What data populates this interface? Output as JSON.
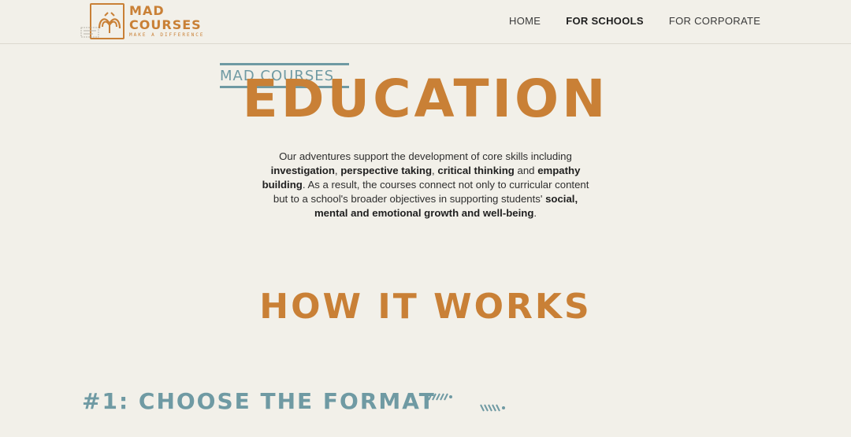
{
  "header": {
    "logo": {
      "title": "MAD COURSES",
      "tagline": "MAKE A DIFFERENCE"
    },
    "nav": {
      "items": [
        {
          "label": "HOME"
        },
        {
          "label": "FOR SCHOOLS",
          "active": true
        },
        {
          "label": "FOR CORPORATE"
        }
      ]
    }
  },
  "hero": {
    "kicker": "MAD COURSES",
    "title": "EDUCATION"
  },
  "intro": {
    "line1_pre": "Our adventures support the development of core skills including",
    "skill1": "investigation",
    "sep1": ", ",
    "skill2": "perspective taking",
    "sep2": ", ",
    "skill3": "critical thinking",
    "sep3": " and ",
    "skill4": "empathy building",
    "mid": ". As a result, the courses connect not only to curricular content but to a school's broader objectives in supporting students' ",
    "growth": "social, mental and emotional growth and well-being",
    "end": "."
  },
  "how_it_works": {
    "title": "HOW IT WORKS",
    "step1": "#1: CHOOSE THE FORMAT"
  },
  "colors": {
    "background": "#f2f0e9",
    "accent_orange": "#c98036",
    "accent_teal": "#6f9aa3"
  },
  "icons": [
    "logo-mark-icon",
    "logo-stamp-icon",
    "squiggle-icon"
  ]
}
